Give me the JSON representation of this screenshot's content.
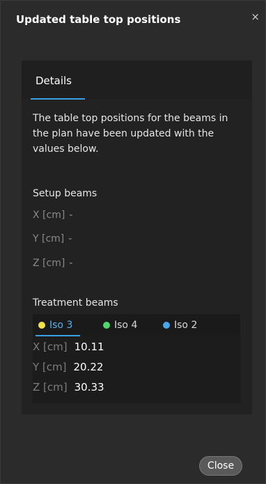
{
  "dialog": {
    "title": "Updated table top positions",
    "close_icon": "×",
    "close_button_label": "Close"
  },
  "tabs": [
    {
      "label": "Details",
      "active": true
    }
  ],
  "description": "The table top positions for the beams in the plan have been updated with the values below.",
  "setup": {
    "title": "Setup beams",
    "rows": [
      {
        "label": "X [cm]",
        "value": "-"
      },
      {
        "label": "Y [cm]",
        "value": "-"
      },
      {
        "label": "Z [cm]",
        "value": "-"
      }
    ]
  },
  "treatment": {
    "title": "Treatment beams",
    "iso_tabs": [
      {
        "label": "Iso 3",
        "color": "#f2e24a",
        "active": true
      },
      {
        "label": "Iso 4",
        "color": "#4fd66a",
        "active": false
      },
      {
        "label": "Iso 2",
        "color": "#49a6e8",
        "active": false
      }
    ],
    "rows": [
      {
        "label": "X [cm]",
        "value": "10.11"
      },
      {
        "label": "Y [cm]",
        "value": "20.22"
      },
      {
        "label": "Z [cm]",
        "value": "30.33"
      }
    ]
  },
  "colors": {
    "accent": "#3aa0e6",
    "background": "#2b2b2b",
    "panel": "#222222"
  }
}
